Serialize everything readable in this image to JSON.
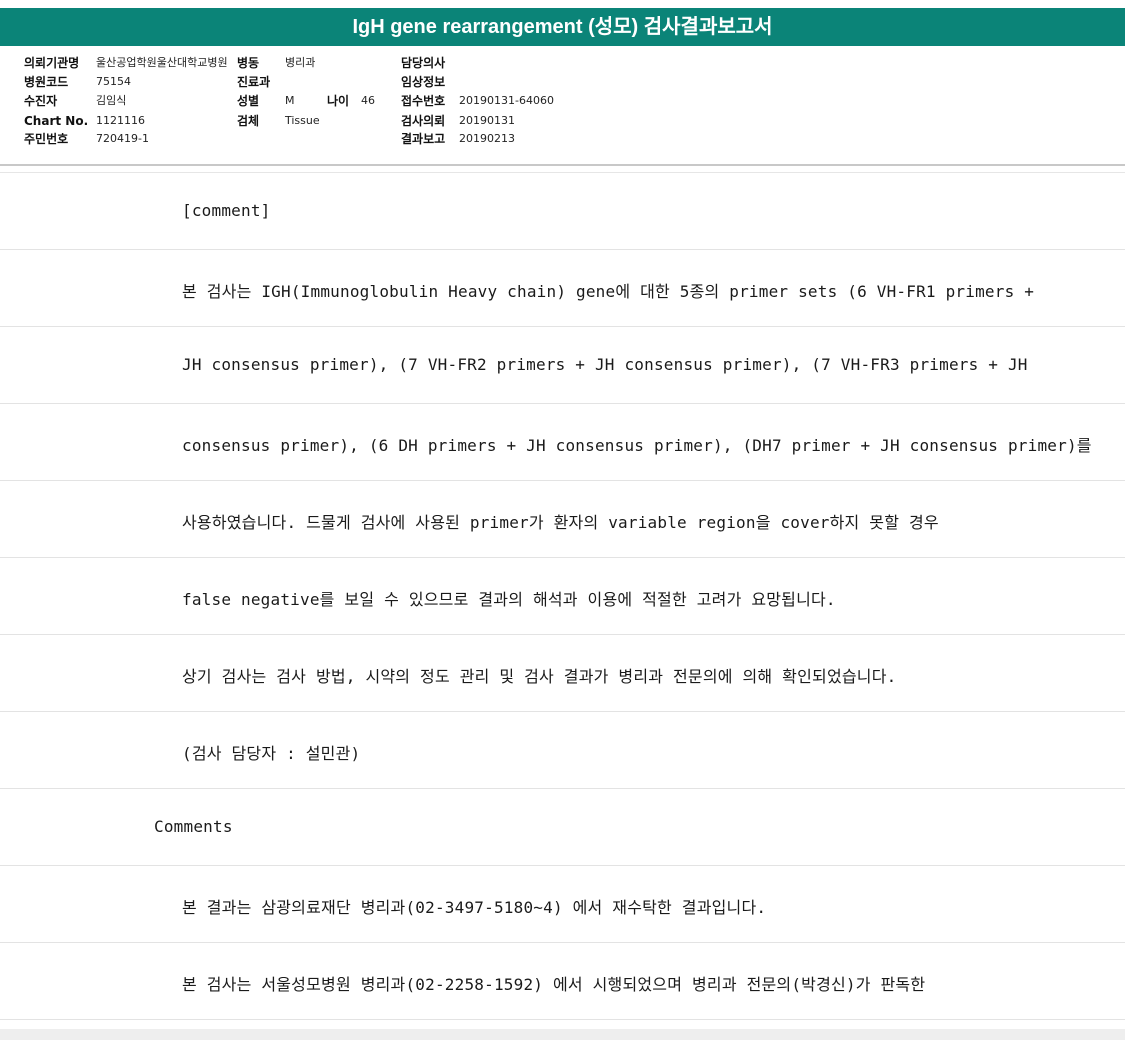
{
  "header": {
    "title": "IgH gene rearrangement (성모) 검사결과보고서"
  },
  "info": {
    "row1": {
      "label1": "의뢰기관명",
      "value1": "울산공업학원울산대학교병원",
      "label2": "병동",
      "value2": "병리과",
      "label3": "담당의사",
      "value3": ""
    },
    "row2": {
      "label1": "병원코드",
      "value1": "75154",
      "label2": "진료과",
      "value2": "",
      "label3": "임상정보",
      "value3": ""
    },
    "row3": {
      "label1": "수진자",
      "value1": "김임식",
      "label2": "성별",
      "value2": "M",
      "label2b": "나이",
      "value2b": "46",
      "label3": "접수번호",
      "value3": "20190131-64060"
    },
    "row4": {
      "label1": "Chart No.",
      "value1": "1121116",
      "label2": "검체",
      "value2": "Tissue",
      "label3": "검사의뢰",
      "value3": "20190131"
    },
    "row5": {
      "label1": "주민번호",
      "value1": "720419-1",
      "label3": "결과보고",
      "value3": "20190213"
    }
  },
  "report": {
    "lines": [
      "[comment]",
      "본 검사는 IGH(Immunoglobulin Heavy chain) gene에 대한 5종의 primer sets (6 VH-FR1 primers +",
      "JH consensus primer), (7 VH-FR2 primers + JH consensus primer), (7 VH-FR3 primers + JH",
      "consensus primer), (6 DH primers + JH consensus primer), (DH7 primer + JH consensus primer)를",
      "사용하였습니다. 드물게 검사에 사용된 primer가 환자의 variable region을 cover하지 못할 경우",
      "false negative를 보일 수 있으므로 결과의 해석과 이용에 적절한 고려가 요망됩니다.",
      "상기 검사는 검사 방법, 시약의 정도 관리 및 검사 결과가 병리과 전문의에 의해 확인되었습니다.",
      "(검사 담당자 : 설민관)",
      "Comments",
      "본 결과는 삼광의료재단 병리과(02-3497-5180~4) 에서 재수탁한 결과입니다.",
      "본 검사는 서울성모병원 병리과(02-2258-1592) 에서 시행되었으며 병리과 전문의(박경신)가 판독한"
    ]
  }
}
